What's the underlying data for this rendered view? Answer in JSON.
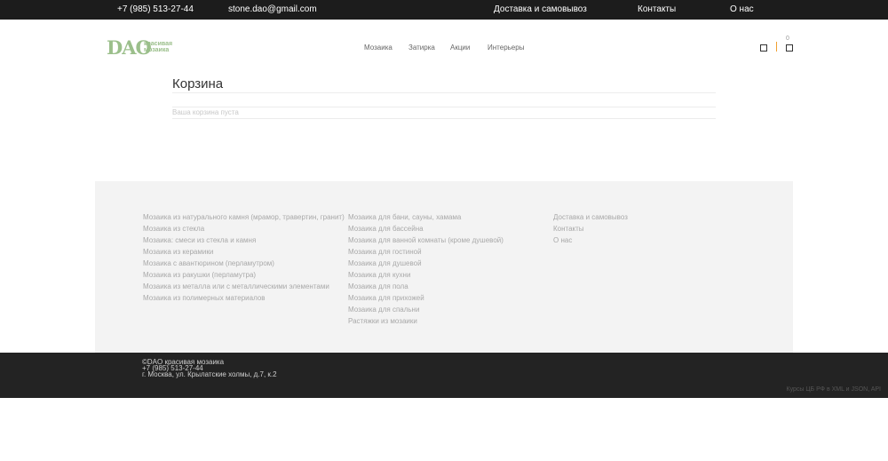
{
  "topbar": {
    "phone": "+7 (985) 513-27-44",
    "email": "stone.dao@gmail.com",
    "links": [
      "Доставка и самовывоз",
      "Контакты",
      "О нас"
    ]
  },
  "logo": {
    "brand": "DAO",
    "tagline_1": "красивая",
    "tagline_2": "мозаика"
  },
  "nav": [
    "Мозаика",
    "Затирка",
    "Акции",
    "Интерьеры"
  ],
  "cart": {
    "count": "0"
  },
  "main": {
    "title": "Корзина",
    "empty_message": "Ваша корзина пуста"
  },
  "footer": {
    "col1": [
      "Мозаика из натурального камня (мрамор, травертин, гранит)",
      "Мозаика из стекла",
      "Мозаика: смеси из стекла и камня",
      "Мозаика из керамики",
      "Мозаика с авантюрином (перламутром)",
      "Мозаика из ракушки (перламутра)",
      "Мозаика из металла или с металлическими элементами",
      "Мозаика из полимерных материалов"
    ],
    "col2": [
      "Мозаика для бани, сауны, хамама",
      "Мозаика для бассейна",
      "Мозаика для ванной комнаты (кроме душевой)",
      "Мозаика для гостиной",
      "Мозаика для душевой",
      "Мозаика для кухни",
      "Мозаика для пола",
      "Мозаика для прихожей",
      "Мозаика для спальни",
      "Растяжки из мозаики"
    ],
    "col3": [
      "Доставка и самовывоз",
      "Контакты",
      "О нас"
    ]
  },
  "bottom": {
    "copyright": "©DAO красивая мозаика",
    "phone": "+7 (985) 513-27-44",
    "address": "г. Москва, ул. Крылатские холмы, д.7, к.2",
    "rates": "Курсы ЦБ РФ в XML и JSON, API"
  },
  "colors": {
    "brand_green": "#9bbf8b",
    "accent_orange": "#f0a030",
    "topbar_bg": "#1c1c1c"
  }
}
